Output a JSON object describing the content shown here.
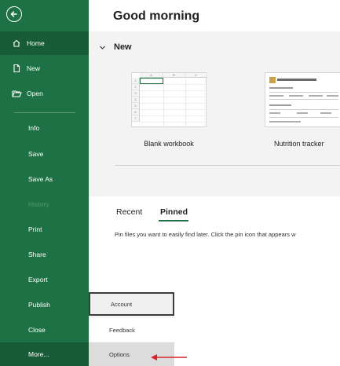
{
  "main": {
    "greeting": "Good morning",
    "new_section_title": "New",
    "templates": [
      {
        "name": "Blank workbook"
      },
      {
        "name": "Nutrition tracker"
      }
    ],
    "blank_grid": {
      "columns": [
        "A",
        "B",
        "C"
      ],
      "rows": [
        "1",
        "2",
        "3",
        "4",
        "5",
        "6",
        "7"
      ]
    },
    "tabs": [
      {
        "label": "Recent"
      },
      {
        "label": "Pinned"
      }
    ],
    "active_tab": "Pinned",
    "pinned_message": "Pin files you want to easily find later. Click the pin icon that appears w"
  },
  "sidebar": {
    "items": [
      {
        "label": "Home",
        "icon": "home-icon"
      },
      {
        "label": "New",
        "icon": "new-file-icon"
      },
      {
        "label": "Open",
        "icon": "folder-open-icon"
      },
      {
        "label": "Info"
      },
      {
        "label": "Save"
      },
      {
        "label": "Save As"
      },
      {
        "label": "History"
      },
      {
        "label": "Print"
      },
      {
        "label": "Share"
      },
      {
        "label": "Export"
      },
      {
        "label": "Publish"
      },
      {
        "label": "Close"
      },
      {
        "label": "More..."
      }
    ]
  },
  "more_menu": {
    "items": [
      {
        "label": "Account"
      },
      {
        "label": "Feedback"
      },
      {
        "label": "Options"
      }
    ]
  },
  "colors": {
    "sidebar": "#1e7145",
    "sidebar_active": "#185c37",
    "annotation_arrow": "#d9232a"
  }
}
